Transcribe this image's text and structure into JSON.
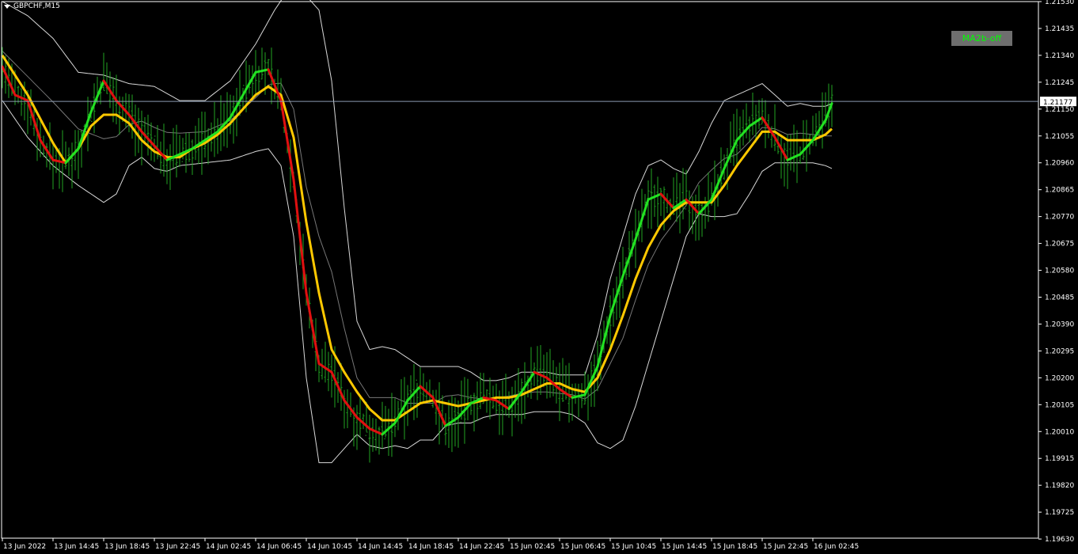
{
  "window": {
    "symbol_title": "GBPCHF,M15"
  },
  "button": {
    "label": "MA2b-off"
  },
  "colors": {
    "background": "#000000",
    "axis": "#ffffff",
    "candles": "#22a322",
    "ma_up": "#22e222",
    "ma_down": "#e01010",
    "ma_slow": "#ffc800",
    "bands": "#d8d8d8",
    "price_line": "#8a9ab0"
  },
  "chart_data": {
    "type": "line",
    "title": "GBPCHF,M15",
    "current_price": "1.21177",
    "ylim": [
      1.19633,
      1.2153
    ],
    "y_ticks": [
      "1.21530",
      "1.21435",
      "1.21340",
      "1.21245",
      "1.21150",
      "1.21055",
      "1.20960",
      "1.20865",
      "1.20770",
      "1.20675",
      "1.20580",
      "1.20485",
      "1.20390",
      "1.20295",
      "1.20200",
      "1.20105",
      "1.20010",
      "1.19915",
      "1.19820",
      "1.19725",
      "1.19630"
    ],
    "x_ticks": [
      "13 Jun 2022",
      "13 Jun 14:45",
      "13 Jun 18:45",
      "13 Jun 22:45",
      "14 Jun 02:45",
      "14 Jun 06:45",
      "14 Jun 10:45",
      "14 Jun 14:45",
      "14 Jun 18:45",
      "14 Jun 22:45",
      "15 Jun 02:45",
      "15 Jun 06:45",
      "15 Jun 10:45",
      "15 Jun 14:45",
      "15 Jun 18:45",
      "15 Jun 22:45",
      "16 Jun 02:45"
    ],
    "x_tick_step_bars": 16,
    "fast_ma": [
      [
        0,
        1.213
      ],
      [
        4,
        1.212
      ],
      [
        8,
        1.2118
      ],
      [
        12,
        1.2104
      ],
      [
        16,
        1.2097
      ],
      [
        20,
        1.2096
      ],
      [
        24,
        1.2101
      ],
      [
        28,
        1.2114
      ],
      [
        32,
        1.2125
      ],
      [
        36,
        1.2118
      ],
      [
        40,
        1.2113
      ],
      [
        44,
        1.2107
      ],
      [
        48,
        1.2102
      ],
      [
        52,
        1.2097
      ],
      [
        56,
        1.2099
      ],
      [
        60,
        1.2101
      ],
      [
        64,
        1.2104
      ],
      [
        68,
        1.2107
      ],
      [
        72,
        1.2112
      ],
      [
        76,
        1.212
      ],
      [
        80,
        1.2128
      ],
      [
        84,
        1.2129
      ],
      [
        88,
        1.2118
      ],
      [
        92,
        1.209
      ],
      [
        96,
        1.205
      ],
      [
        100,
        1.2025
      ],
      [
        104,
        1.2022
      ],
      [
        108,
        1.2012
      ],
      [
        112,
        1.2006
      ],
      [
        116,
        1.2002
      ],
      [
        120,
        1.2
      ],
      [
        124,
        1.2004
      ],
      [
        128,
        1.2012
      ],
      [
        132,
        1.2017
      ],
      [
        136,
        1.2013
      ],
      [
        140,
        1.2003
      ],
      [
        144,
        1.2006
      ],
      [
        148,
        1.2011
      ],
      [
        152,
        1.2013
      ],
      [
        156,
        1.2012
      ],
      [
        160,
        1.2009
      ],
      [
        164,
        1.2015
      ],
      [
        168,
        1.2022
      ],
      [
        172,
        1.202
      ],
      [
        176,
        1.2016
      ],
      [
        180,
        1.2013
      ],
      [
        184,
        1.2014
      ],
      [
        188,
        1.2024
      ],
      [
        192,
        1.2042
      ],
      [
        196,
        1.2056
      ],
      [
        200,
        1.2069
      ],
      [
        204,
        1.2083
      ],
      [
        208,
        1.2085
      ],
      [
        212,
        1.208
      ],
      [
        216,
        1.2083
      ],
      [
        220,
        1.2078
      ],
      [
        224,
        1.2083
      ],
      [
        228,
        1.2094
      ],
      [
        232,
        1.2104
      ],
      [
        236,
        1.2109
      ],
      [
        240,
        1.2112
      ],
      [
        244,
        1.2105
      ],
      [
        248,
        1.2097
      ],
      [
        252,
        1.2099
      ],
      [
        256,
        1.2104
      ],
      [
        260,
        1.2111
      ],
      [
        262,
        1.2117
      ]
    ],
    "slow_ma": [
      [
        0,
        1.2134
      ],
      [
        8,
        1.212
      ],
      [
        16,
        1.2103
      ],
      [
        20,
        1.2096
      ],
      [
        24,
        1.2101
      ],
      [
        28,
        1.2109
      ],
      [
        32,
        1.2113
      ],
      [
        36,
        1.2113
      ],
      [
        40,
        1.211
      ],
      [
        44,
        1.2104
      ],
      [
        48,
        1.21
      ],
      [
        52,
        1.2098
      ],
      [
        56,
        1.2098
      ],
      [
        60,
        1.2101
      ],
      [
        64,
        1.2103
      ],
      [
        68,
        1.2106
      ],
      [
        72,
        1.211
      ],
      [
        76,
        1.2115
      ],
      [
        80,
        1.212
      ],
      [
        84,
        1.2123
      ],
      [
        88,
        1.212
      ],
      [
        92,
        1.2105
      ],
      [
        96,
        1.2075
      ],
      [
        100,
        1.205
      ],
      [
        104,
        1.203
      ],
      [
        108,
        1.2022
      ],
      [
        112,
        1.2015
      ],
      [
        116,
        1.2009
      ],
      [
        120,
        1.2005
      ],
      [
        124,
        1.2005
      ],
      [
        128,
        1.2008
      ],
      [
        132,
        1.2011
      ],
      [
        136,
        1.2012
      ],
      [
        140,
        1.2011
      ],
      [
        144,
        1.201
      ],
      [
        148,
        1.2011
      ],
      [
        152,
        1.2012
      ],
      [
        156,
        1.2013
      ],
      [
        160,
        1.2013
      ],
      [
        164,
        1.2014
      ],
      [
        168,
        1.2016
      ],
      [
        172,
        1.2018
      ],
      [
        176,
        1.2018
      ],
      [
        180,
        1.2016
      ],
      [
        184,
        1.2015
      ],
      [
        188,
        1.202
      ],
      [
        192,
        1.203
      ],
      [
        196,
        1.2042
      ],
      [
        200,
        1.2055
      ],
      [
        204,
        1.2066
      ],
      [
        208,
        1.2074
      ],
      [
        212,
        1.2079
      ],
      [
        216,
        1.2082
      ],
      [
        220,
        1.2082
      ],
      [
        224,
        1.2082
      ],
      [
        228,
        1.2088
      ],
      [
        232,
        1.2095
      ],
      [
        236,
        1.2101
      ],
      [
        240,
        1.2107
      ],
      [
        244,
        1.2107
      ],
      [
        248,
        1.2104
      ],
      [
        252,
        1.2104
      ],
      [
        256,
        1.2104
      ],
      [
        260,
        1.2106
      ],
      [
        262,
        1.2108
      ]
    ],
    "upper_band": [
      [
        0,
        1.2153
      ],
      [
        8,
        1.2148
      ],
      [
        16,
        1.214
      ],
      [
        24,
        1.2128
      ],
      [
        32,
        1.2127
      ],
      [
        40,
        1.2124
      ],
      [
        48,
        1.2123
      ],
      [
        56,
        1.2118
      ],
      [
        64,
        1.2118
      ],
      [
        72,
        1.2125
      ],
      [
        80,
        1.2138
      ],
      [
        86,
        1.215
      ],
      [
        92,
        1.216
      ],
      [
        100,
        1.215
      ],
      [
        104,
        1.2125
      ],
      [
        108,
        1.208
      ],
      [
        112,
        1.204
      ],
      [
        116,
        1.203
      ],
      [
        120,
        1.2031
      ],
      [
        124,
        1.203
      ],
      [
        128,
        1.2027
      ],
      [
        132,
        1.2024
      ],
      [
        136,
        1.2024
      ],
      [
        140,
        1.2024
      ],
      [
        144,
        1.2024
      ],
      [
        148,
        1.2022
      ],
      [
        152,
        1.2019
      ],
      [
        156,
        1.2019
      ],
      [
        160,
        1.202
      ],
      [
        164,
        1.2022
      ],
      [
        168,
        1.2022
      ],
      [
        172,
        1.2022
      ],
      [
        176,
        1.2021
      ],
      [
        180,
        1.2021
      ],
      [
        184,
        1.2021
      ],
      [
        188,
        1.2035
      ],
      [
        192,
        1.2055
      ],
      [
        196,
        1.207
      ],
      [
        200,
        1.2085
      ],
      [
        204,
        1.2095
      ],
      [
        208,
        1.2097
      ],
      [
        212,
        1.2094
      ],
      [
        216,
        1.2092
      ],
      [
        220,
        1.21
      ],
      [
        224,
        1.211
      ],
      [
        228,
        1.2118
      ],
      [
        232,
        1.212
      ],
      [
        236,
        1.2122
      ],
      [
        240,
        1.2124
      ],
      [
        244,
        1.212
      ],
      [
        248,
        1.2116
      ],
      [
        252,
        1.2117
      ],
      [
        256,
        1.2116
      ],
      [
        260,
        1.2116
      ],
      [
        262,
        1.2117
      ]
    ],
    "lower_band": [
      [
        0,
        1.2118
      ],
      [
        8,
        1.2105
      ],
      [
        16,
        1.2095
      ],
      [
        24,
        1.2088
      ],
      [
        32,
        1.2082
      ],
      [
        36,
        1.2085
      ],
      [
        40,
        1.2095
      ],
      [
        44,
        1.2098
      ],
      [
        48,
        1.2094
      ],
      [
        52,
        1.2093
      ],
      [
        56,
        1.2095
      ],
      [
        64,
        1.2096
      ],
      [
        72,
        1.2097
      ],
      [
        80,
        1.21
      ],
      [
        84,
        1.2101
      ],
      [
        88,
        1.2095
      ],
      [
        92,
        1.207
      ],
      [
        96,
        1.202
      ],
      [
        100,
        1.199
      ],
      [
        104,
        1.199
      ],
      [
        108,
        1.1995
      ],
      [
        112,
        1.2
      ],
      [
        116,
        1.1996
      ],
      [
        120,
        1.1995
      ],
      [
        124,
        1.1996
      ],
      [
        128,
        1.1995
      ],
      [
        132,
        1.1998
      ],
      [
        136,
        1.1998
      ],
      [
        140,
        1.2003
      ],
      [
        144,
        1.2004
      ],
      [
        148,
        1.2004
      ],
      [
        152,
        1.2006
      ],
      [
        156,
        1.2007
      ],
      [
        160,
        1.2007
      ],
      [
        164,
        1.2007
      ],
      [
        168,
        1.2008
      ],
      [
        172,
        1.2008
      ],
      [
        176,
        1.2008
      ],
      [
        180,
        1.2007
      ],
      [
        184,
        1.2004
      ],
      [
        188,
        1.1997
      ],
      [
        192,
        1.1995
      ],
      [
        196,
        1.1998
      ],
      [
        200,
        1.201
      ],
      [
        204,
        1.2025
      ],
      [
        208,
        1.204
      ],
      [
        212,
        1.2055
      ],
      [
        216,
        1.207
      ],
      [
        220,
        1.2078
      ],
      [
        224,
        1.2077
      ],
      [
        228,
        1.2077
      ],
      [
        232,
        1.2078
      ],
      [
        236,
        1.2085
      ],
      [
        240,
        1.2093
      ],
      [
        244,
        1.2096
      ],
      [
        248,
        1.2096
      ],
      [
        252,
        1.2096
      ],
      [
        256,
        1.2096
      ],
      [
        260,
        1.2095
      ],
      [
        262,
        1.2094
      ]
    ]
  }
}
